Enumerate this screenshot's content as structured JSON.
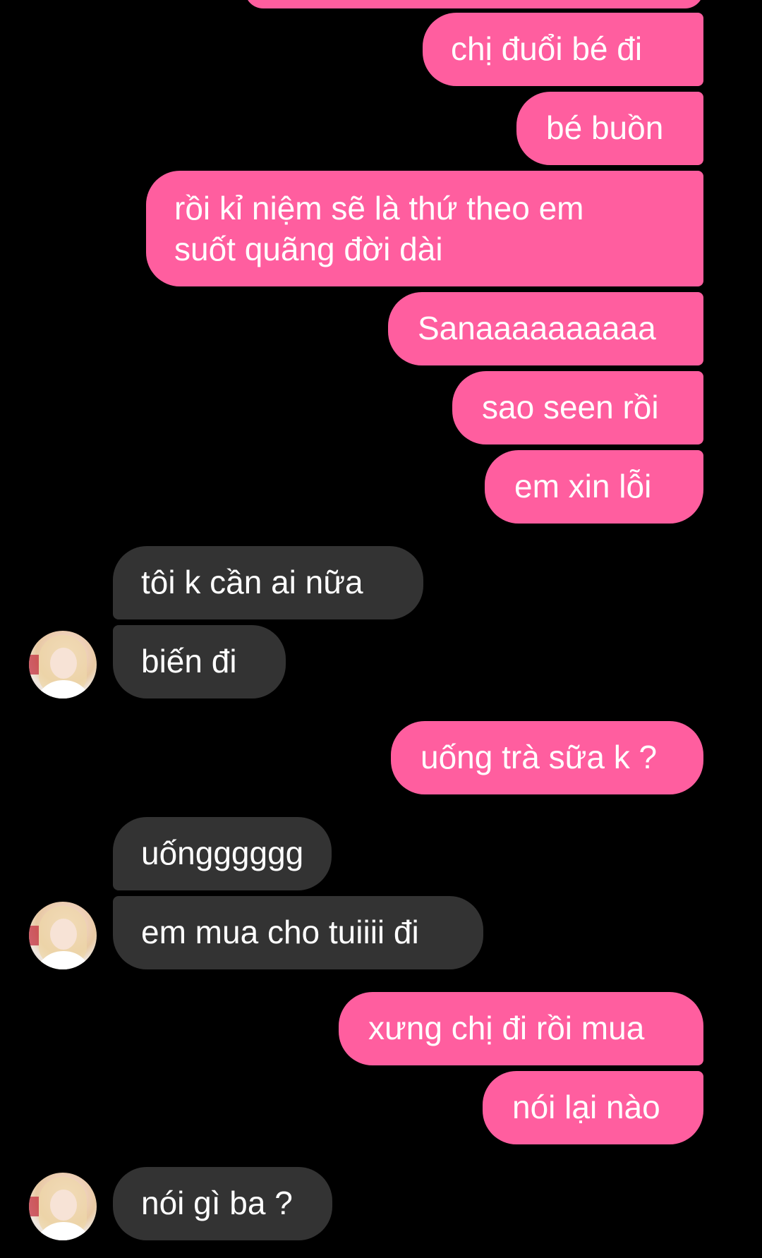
{
  "theme": {
    "background": "#000000",
    "outgoing_bubble_color": "#ff5e9f",
    "incoming_bubble_color": "#333333",
    "text_color": "#ffffff"
  },
  "messages": [
    {
      "sender": "me",
      "text": ""
    },
    {
      "sender": "me",
      "text": "chị đuổi bé đi"
    },
    {
      "sender": "me",
      "text": "bé buồn"
    },
    {
      "sender": "me",
      "lines": [
        "rồi kỉ niệm sẽ là thứ theo em",
        "suốt quãng đời dài"
      ]
    },
    {
      "sender": "me",
      "text": "Sanaaaaaaaaaa"
    },
    {
      "sender": "me",
      "text": "sao seen rồi"
    },
    {
      "sender": "me",
      "text": "em xin lỗi"
    },
    {
      "sender": "them",
      "text": "tôi k cần ai nữa"
    },
    {
      "sender": "them",
      "text": "biến đi",
      "avatar": true
    },
    {
      "sender": "me",
      "text": "uống trà sữa k ?"
    },
    {
      "sender": "them",
      "text": "uốngggggg"
    },
    {
      "sender": "them",
      "text": "em mua cho tuiiii đi",
      "avatar": true
    },
    {
      "sender": "me",
      "text": "xưng chị đi rồi mua"
    },
    {
      "sender": "me",
      "text": "nói lại nào"
    },
    {
      "sender": "them",
      "text": "nói gì ba ?",
      "avatar": true
    }
  ],
  "avatar_icon": "profile-photo-avatar"
}
